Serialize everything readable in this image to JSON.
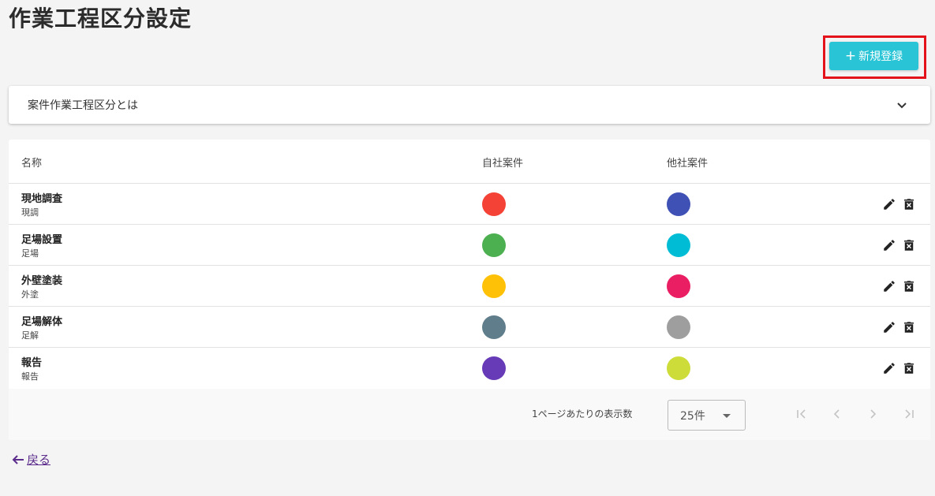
{
  "page": {
    "title": "作業工程区分設定"
  },
  "toolbar": {
    "new_button_label": "新規登録",
    "new_button_icon": "+"
  },
  "accordion": {
    "label": "案件作業工程区分とは",
    "icon": "chevron-down-icon"
  },
  "table": {
    "headers": {
      "name": "名称",
      "own": "自社案件",
      "other": "他社案件"
    },
    "rows": [
      {
        "name": "現地調査",
        "abbr": "現調",
        "own_color": "#f44336",
        "other_color": "#3f51b5"
      },
      {
        "name": "足場設置",
        "abbr": "足場",
        "own_color": "#4caf50",
        "other_color": "#00bcd4"
      },
      {
        "name": "外壁塗装",
        "abbr": "外塗",
        "own_color": "#ffc107",
        "other_color": "#e91e63"
      },
      {
        "name": "足場解体",
        "abbr": "足解",
        "own_color": "#607d8b",
        "other_color": "#9e9e9e"
      },
      {
        "name": "報告",
        "abbr": "報告",
        "own_color": "#673ab7",
        "other_color": "#cddc39"
      }
    ]
  },
  "pagination": {
    "per_page_label": "1ページあたりの表示数",
    "per_page_value": "25件"
  },
  "back_link": {
    "label": "戻る"
  },
  "colors": {
    "accent": "#29c4d6",
    "highlight": "#e4131b",
    "link": "#5b2c8c"
  }
}
